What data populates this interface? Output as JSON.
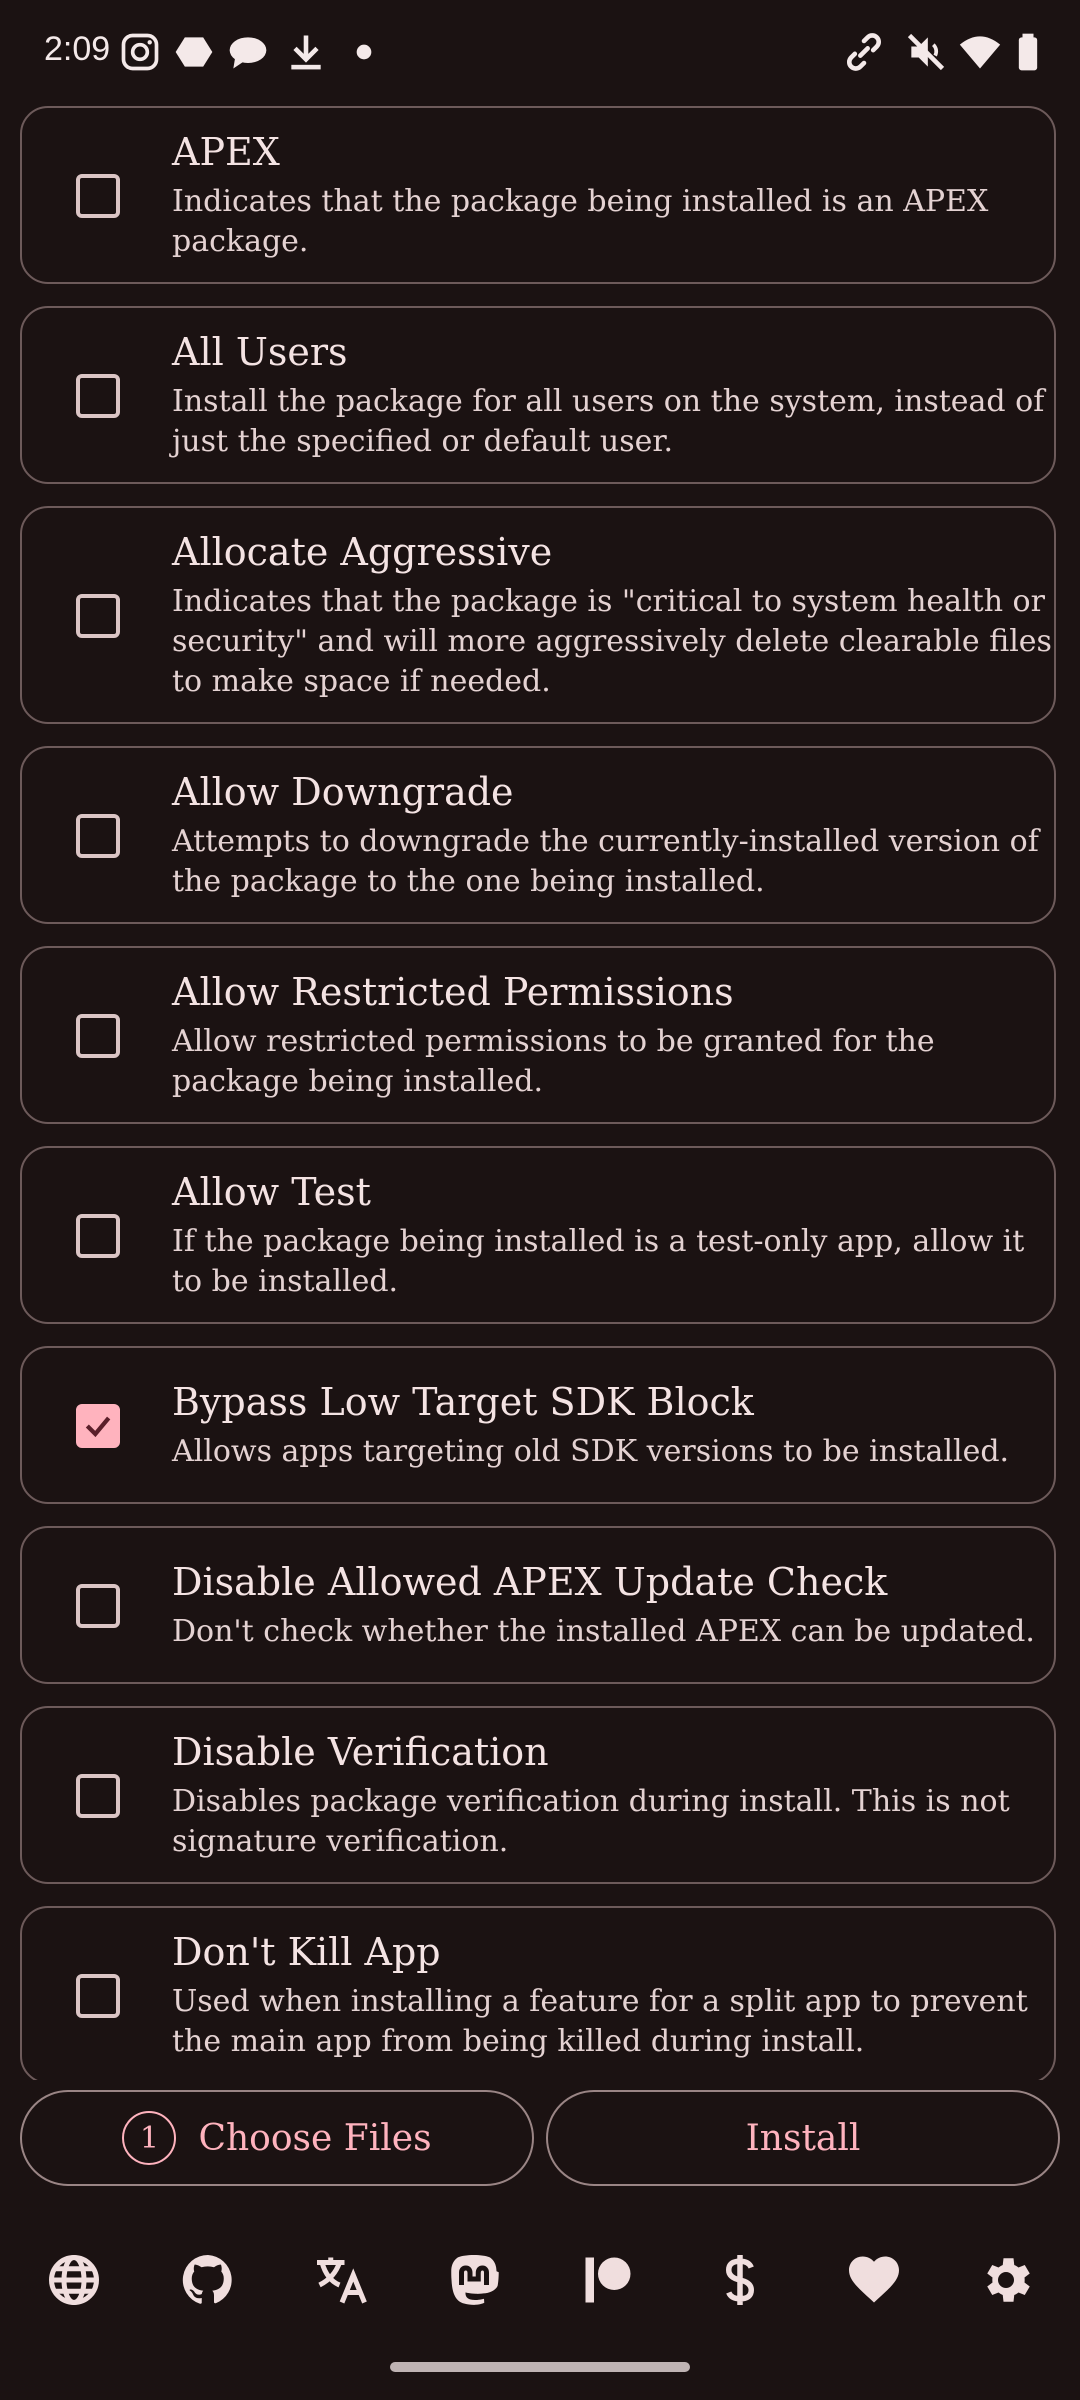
{
  "status_bar": {
    "time": "2:09",
    "icons": [
      "instagram-icon",
      "hexagon-icon",
      "chat-bubble-icon",
      "download-icon",
      "dot-icon",
      "link-icon",
      "mute-icon",
      "wifi-icon",
      "battery-icon"
    ]
  },
  "options": [
    {
      "title": "APEX",
      "description": "Indicates that the package being installed is an APEX package.",
      "checked": false
    },
    {
      "title": "All Users",
      "description": "Install the package for all users on the system, instead of just the specified or default user.",
      "checked": false
    },
    {
      "title": "Allocate Aggressive",
      "description": "Indicates that the package is \"critical to system health or security\" and will more aggressively delete clearable files to make space if needed.",
      "checked": false
    },
    {
      "title": "Allow Downgrade",
      "description": "Attempts to downgrade the currently-installed version of the package to the one being installed.",
      "checked": false
    },
    {
      "title": "Allow Restricted Permissions",
      "description": "Allow restricted permissions to be granted for the package being installed.",
      "checked": false
    },
    {
      "title": "Allow Test",
      "description": "If the package being installed is a test-only app, allow it to be installed.",
      "checked": false
    },
    {
      "title": "Bypass Low Target SDK Block",
      "description": "Allows apps targeting old SDK versions to be installed.",
      "checked": true
    },
    {
      "title": "Disable Allowed APEX Update Check",
      "description": "Don't check whether the installed APEX can be updated.",
      "checked": false
    },
    {
      "title": "Disable Verification",
      "description": "Disables package verification during install. This is not signature verification.",
      "checked": false
    },
    {
      "title": "Don't Kill App",
      "description": "Used when installing a feature for a split app to prevent the main app from being killed during install.",
      "checked": false
    }
  ],
  "actions": {
    "choose_files_count": "1",
    "choose_files_label": "Choose Files",
    "install_label": "Install"
  },
  "bottom_nav": [
    "globe-icon",
    "github-icon",
    "translate-icon",
    "mastodon-icon",
    "patreon-icon",
    "dollar-icon",
    "heart-icon",
    "settings-icon"
  ],
  "colors": {
    "background": "#1b1212",
    "accent": "#ffb3be",
    "card_border": "#6d5a5a",
    "text": "#f4e3e3"
  }
}
